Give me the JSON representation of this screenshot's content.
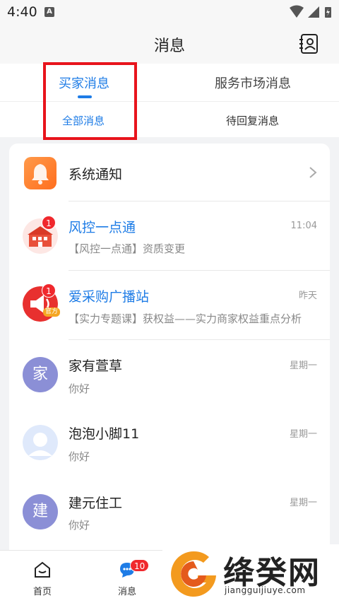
{
  "status_bar": {
    "time": "4:40",
    "notif_letter": "A"
  },
  "header": {
    "title": "消息"
  },
  "tabs": {
    "main": [
      {
        "label": "买家消息",
        "active": true
      },
      {
        "label": "服务市场消息",
        "active": false
      }
    ],
    "sub": [
      {
        "label": "全部消息",
        "active": true
      },
      {
        "label": "待回复消息",
        "active": false
      }
    ]
  },
  "system_row": {
    "label": "系统通知"
  },
  "messages": [
    {
      "name": "风控一点通",
      "preview": "【风控一点通】资质变更",
      "time": "11:04",
      "badge": "1",
      "official": false
    },
    {
      "name": "爱采购广播站",
      "preview": "【实力专题课】获权益——实力商家权益重点分析",
      "time": "昨天",
      "badge": "1",
      "official": true,
      "official_label": "官方"
    },
    {
      "name": "家有萱草",
      "preview": "你好",
      "time": "星期一",
      "avatar_text": "家"
    },
    {
      "name": "泡泡小脚11",
      "preview": "你好",
      "time": "星期一"
    },
    {
      "name": "建元住工",
      "preview": "你好",
      "time": "星期一",
      "avatar_text": "建"
    }
  ],
  "bottom_nav": {
    "items": [
      {
        "label": "首页"
      },
      {
        "label": "消息",
        "badge": "10"
      }
    ]
  },
  "watermark": {
    "text": "绛癸网",
    "url": "jiangguijiuye.com"
  },
  "colors": {
    "accent": "#1e7ce6",
    "badge": "#f0282d",
    "highlight": "#e8141c"
  }
}
